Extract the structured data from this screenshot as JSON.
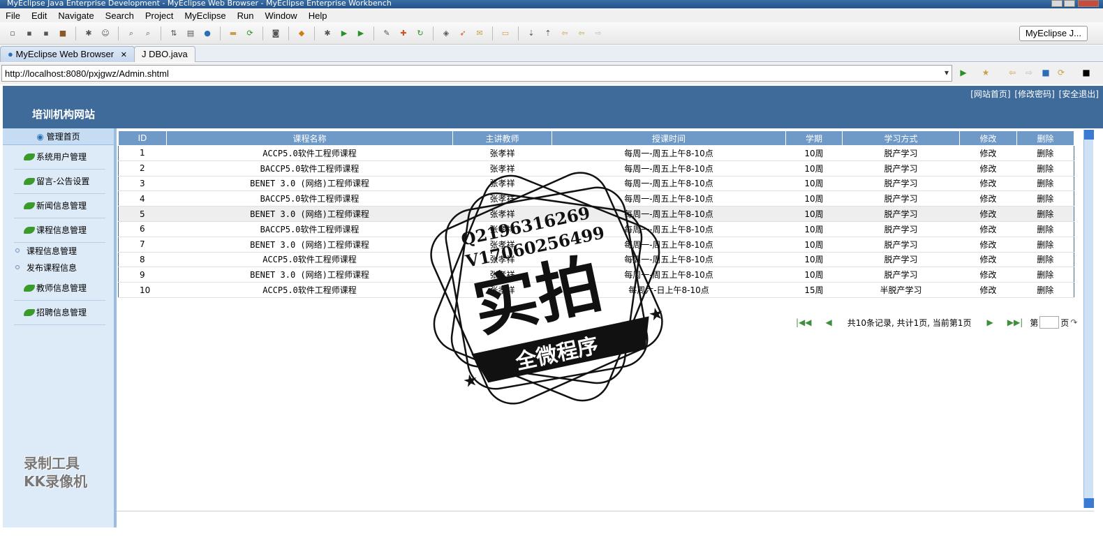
{
  "window": {
    "title": "MyEclipse Java Enterprise Development - MyEclipse Web Browser - MyEclipse Enterprise Workbench"
  },
  "menu": [
    "File",
    "Edit",
    "Navigate",
    "Search",
    "Project",
    "MyEclipse",
    "Run",
    "Window",
    "Help"
  ],
  "perspective": "MyEclipse J...",
  "tabs": {
    "active": "MyEclipse Web Browser",
    "other": "DBO.java"
  },
  "url": "http://localhost:8080/pxjgwz/Admin.shtml",
  "header": {
    "title": "培训机构网站",
    "links": [
      "[网站首页]",
      "[修改密码]",
      "[安全退出]"
    ]
  },
  "sidebar": {
    "home": "管理首页",
    "items": [
      "系统用户管理",
      "留言-公告设置",
      "新闻信息管理",
      "课程信息管理",
      "教师信息管理",
      "招聘信息管理"
    ],
    "subitems": [
      "课程信息管理",
      "发布课程信息"
    ]
  },
  "table": {
    "columns": [
      "ID",
      "课程名称",
      "主讲教师",
      "授课时间",
      "学期",
      "学习方式",
      "修改",
      "删除"
    ],
    "rows": [
      [
        "1",
        "ACCP5.0软件工程师课程",
        "张孝祥",
        "每周一-周五上午8-10点",
        "10周",
        "脱产学习",
        "修改",
        "删除"
      ],
      [
        "2",
        "BACCP5.0软件工程师课程",
        "张孝祥",
        "每周一-周五上午8-10点",
        "10周",
        "脱产学习",
        "修改",
        "删除"
      ],
      [
        "3",
        "BENET 3.0 (网络)工程师课程",
        "张孝祥",
        "每周一-周五上午8-10点",
        "10周",
        "脱产学习",
        "修改",
        "删除"
      ],
      [
        "4",
        "BACCP5.0软件工程师课程",
        "张孝祥",
        "每周一-周五上午8-10点",
        "10周",
        "脱产学习",
        "修改",
        "删除"
      ],
      [
        "5",
        "BENET 3.0 (网络)工程师课程",
        "张孝祥",
        "每周一-周五上午8-10点",
        "10周",
        "脱产学习",
        "修改",
        "删除"
      ],
      [
        "6",
        "BACCP5.0软件工程师课程",
        "张孝祥",
        "每周一-周五上午8-10点",
        "10周",
        "脱产学习",
        "修改",
        "删除"
      ],
      [
        "7",
        "BENET 3.0 (网络)工程师课程",
        "张孝祥",
        "每周一-周五上午8-10点",
        "10周",
        "脱产学习",
        "修改",
        "删除"
      ],
      [
        "8",
        "ACCP5.0软件工程师课程",
        "张孝祥",
        "每周一-周五上午8-10点",
        "10周",
        "脱产学习",
        "修改",
        "删除"
      ],
      [
        "9",
        "BENET 3.0 (网络)工程师课程",
        "张孝祥",
        "每周一-周五上午8-10点",
        "10周",
        "脱产学习",
        "修改",
        "删除"
      ],
      [
        "10",
        "ACCP5.0软件工程师课程",
        "张孝祥",
        "每周六-日上午8-10点",
        "15周",
        "半脱产学习",
        "修改",
        "删除"
      ]
    ]
  },
  "pager": {
    "summary": "共10条记录, 共计1页, 当前第1页",
    "page_prefix": "第",
    "page_suffix": "页"
  },
  "watermark": {
    "qq": "Q2196316269",
    "vx": "V17060256499",
    "main": "实拍",
    "banner": "全微程序"
  },
  "recorder": {
    "line1": "录制工具",
    "line2": "KK录像机"
  },
  "colors": {
    "header": "#3f6b9a",
    "table_header": "#6f9ac8",
    "sidebar": "#ddeaf7"
  }
}
